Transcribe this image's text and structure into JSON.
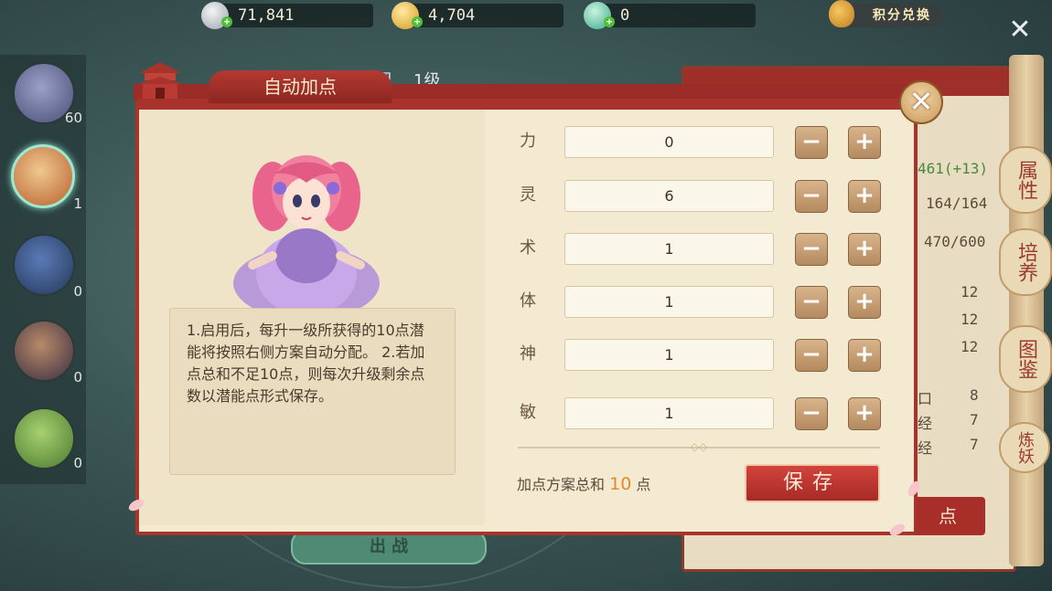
{
  "currency": {
    "silver": "71,841",
    "gold": "4,704",
    "jade": "0",
    "exchange_label": "积分兑换"
  },
  "pets": [
    {
      "level": "60"
    },
    {
      "level": "1"
    },
    {
      "level": "0"
    },
    {
      "level": "0"
    },
    {
      "level": "0"
    }
  ],
  "background": {
    "name_fragment": "圆",
    "level_fragment": "1级",
    "stats": [
      "461(+13)",
      "164/164",
      "470/600",
      "12",
      "12",
      "12",
      "8",
      "7",
      "7"
    ],
    "stat_row_glyphs": [
      "口",
      "经",
      "经"
    ],
    "behind_button_fragment": "出 战",
    "distribute_fragment": "点",
    "side_tabs": [
      "属性",
      "培养",
      "图鉴",
      "炼妖"
    ]
  },
  "dialog": {
    "title": "自动加点",
    "description": "1.启用后，每升一级所获得的10点潜能将按照右侧方案自动分配。 2.若加点总和不足10点，则每次升级剩余点数以潜能点形式保存。",
    "stats": [
      {
        "label": "力",
        "value": "0"
      },
      {
        "label": "灵",
        "value": "6"
      },
      {
        "label": "术",
        "value": "1"
      },
      {
        "label": "体",
        "value": "1"
      },
      {
        "label": "神",
        "value": "1"
      },
      {
        "label": "敏",
        "value": "1"
      }
    ],
    "minus": "−",
    "plus": "+",
    "total_prefix": "加点方案总和",
    "total_value": "10",
    "total_suffix": "点",
    "save_label": "保存",
    "close": "✕"
  },
  "top_close": "✕",
  "colors": {
    "accent_red": "#a7332c",
    "parchment": "#f4ead1",
    "highlight_orange": "#e08a2a"
  }
}
